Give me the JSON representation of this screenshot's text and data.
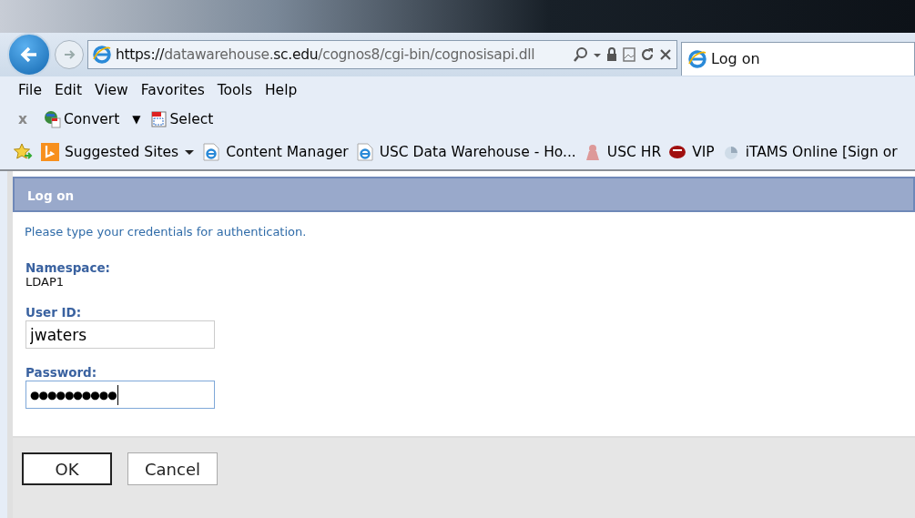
{
  "address_bar": {
    "url_prefix": "https://",
    "url_host": "datawarehouse.",
    "url_domain": "sc.edu",
    "url_path": "/cognos8/cgi-bin/cognosisapi.dll"
  },
  "tab": {
    "title": "Log on",
    "selected": true
  },
  "menu": [
    "File",
    "Edit",
    "View",
    "Favorites",
    "Tools",
    "Help"
  ],
  "command_bar": [
    {
      "kind": "close",
      "label": "x"
    },
    {
      "kind": "convert",
      "label": "Convert"
    },
    {
      "kind": "dropdown",
      "label": "▼"
    },
    {
      "kind": "select",
      "label": "Select"
    }
  ],
  "favorites": [
    {
      "kind": "bing",
      "label": "Suggested Sites",
      "dropdown": true
    },
    {
      "kind": "ie",
      "label": "Content Manager",
      "dropdown": false
    },
    {
      "kind": "ie",
      "label": "USC Data Warehouse - Ho...",
      "dropdown": false
    },
    {
      "kind": "figure",
      "label": "USC HR",
      "dropdown": false
    },
    {
      "kind": "vip",
      "label": "VIP",
      "dropdown": false
    },
    {
      "kind": "itams",
      "label": "iTAMS Online [Sign or",
      "dropdown": false
    }
  ],
  "panel": {
    "title": "Log on",
    "instructions": "Please type your credentials for authentication."
  },
  "namespace": {
    "label": "Namespace:",
    "value": "LDAP1"
  },
  "user_id": {
    "label": "User ID:",
    "value": "jwaters"
  },
  "password": {
    "label": "Password:",
    "value": "●●●●●●●●●●",
    "focused": true
  },
  "buttons": [
    {
      "label": "OK",
      "default": true
    },
    {
      "label": "Cancel",
      "default": false
    }
  ]
}
